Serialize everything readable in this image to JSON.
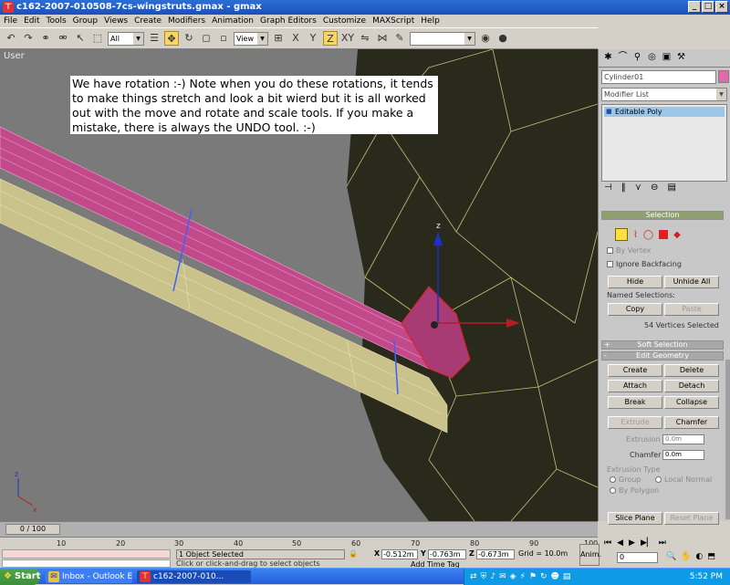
{
  "window": {
    "title": "c162-2007-010508-7cs-wingstruts.gmax - gmax",
    "app_icon": "gmax-app-icon",
    "controls": [
      "_",
      "□",
      "×"
    ]
  },
  "menu": [
    "File",
    "Edit",
    "Tools",
    "Group",
    "Views",
    "Create",
    "Modifiers",
    "Animation",
    "Graph Editors",
    "Customize",
    "MAXScript",
    "Help"
  ],
  "toolbar": {
    "selection_filter": "All",
    "reference_coord": "View"
  },
  "viewport": {
    "label": "User",
    "annotation": "We have rotation :-)  Note when you do these rotations, it tends to make things stretch  and look a bit wierd but it is all worked out with the move and rotate and scale tools.  If you make a mistake, there is always the UNDO tool. :-)",
    "axis_z": "z",
    "gizmo_z": "z",
    "axis_x": "x"
  },
  "command_panel": {
    "object_name": "Cylinder01",
    "modifier_list": "Modifier List",
    "stack_item": "Editable Poly",
    "selection": {
      "title": "Selection",
      "by_vertex": "By Vertex",
      "ignore_backfacing": "Ignore Backfacing",
      "hide": "Hide",
      "unhide_all": "Unhide All",
      "named_selections": "Named Selections:",
      "copy": "Copy",
      "paste": "Paste",
      "status": "54 Vertices Selected"
    },
    "soft_selection": {
      "title": "Soft Selection",
      "sign": "+"
    },
    "edit_geometry": {
      "title": "Edit Geometry",
      "sign": "-",
      "create": "Create",
      "delete": "Delete",
      "attach": "Attach",
      "detach": "Detach",
      "break": "Break",
      "collapse": "Collapse",
      "extrude": "Extrude",
      "chamfer": "Chamfer",
      "extrusion_label": "Extrusion",
      "extrusion_value": "0.0m",
      "chamfer_label": "Chamfer",
      "chamfer_value": "0.0m",
      "extrusion_type": "Extrusion Type",
      "group": "Group",
      "local_normal": "Local Normal",
      "by_polygon": "By Polygon",
      "slice_plane": "Slice Plane",
      "reset_plane": "Reset Plane"
    }
  },
  "timeline": {
    "thumb": "0 / 100",
    "ticks": [
      "10",
      "20",
      "30",
      "40",
      "50",
      "60",
      "70",
      "80",
      "90",
      "100"
    ]
  },
  "status": {
    "selection": "1 Object Selected",
    "prompt": "Click or click-and-drag to select objects",
    "x_label": "X",
    "x": "-0.512m",
    "y_label": "Y",
    "y": "-0.763m",
    "z_label": "Z",
    "z": "-0.673m",
    "grid": "Grid = 10.0m",
    "add_time_tag": "Add Time Tag",
    "anim": "Anim.",
    "frame": "0"
  },
  "taskbar": {
    "start": "Start",
    "tasks": [
      {
        "label": "Inbox - Outlook E...",
        "icon": "outlook-icon"
      },
      {
        "label": "c162-2007-010...",
        "icon": "gmax-icon"
      }
    ],
    "clock": "5:52 PM"
  },
  "colors": {
    "title_bar": "#1c4fb8",
    "viewport_bg": "#7a7a7a",
    "strut_pink": "#c24a8a",
    "strut_tan": "#c9c28a",
    "selection_red": "#e02020",
    "taskbar": "#245edb"
  }
}
